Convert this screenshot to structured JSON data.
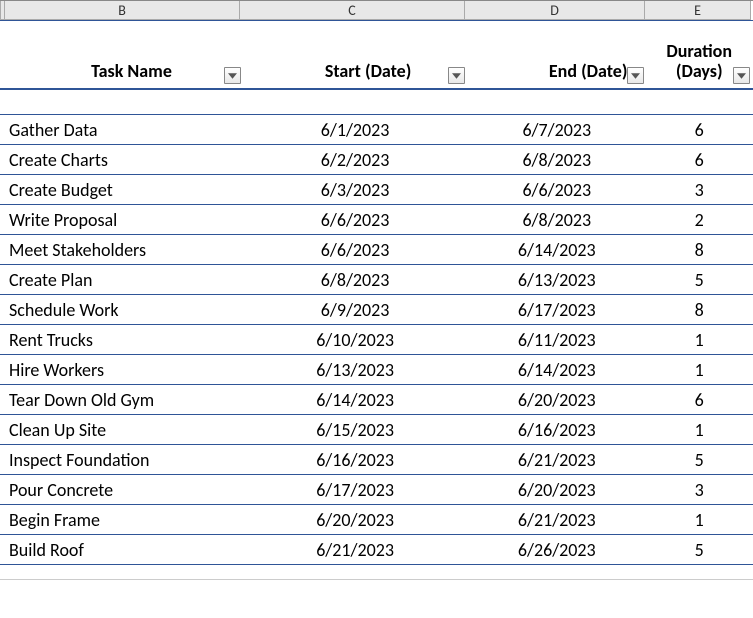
{
  "columns": {
    "B": "B",
    "C": "C",
    "D": "D",
    "E": "E"
  },
  "headers": {
    "task": "Task Name",
    "start": "Start  (Date)",
    "end": "End  (Date)",
    "duration_line1": "Duration",
    "duration_line2": "(Days)"
  },
  "rows": [
    {
      "task": "Gather Data",
      "start": "6/1/2023",
      "end": "6/7/2023",
      "duration": "6"
    },
    {
      "task": "Create Charts",
      "start": "6/2/2023",
      "end": "6/8/2023",
      "duration": "6"
    },
    {
      "task": "Create Budget",
      "start": "6/3/2023",
      "end": "6/6/2023",
      "duration": "3"
    },
    {
      "task": "Write Proposal",
      "start": "6/6/2023",
      "end": "6/8/2023",
      "duration": "2"
    },
    {
      "task": "Meet Stakeholders",
      "start": "6/6/2023",
      "end": "6/14/2023",
      "duration": "8"
    },
    {
      "task": "Create Plan",
      "start": "6/8/2023",
      "end": "6/13/2023",
      "duration": "5"
    },
    {
      "task": "Schedule Work",
      "start": "6/9/2023",
      "end": "6/17/2023",
      "duration": "8"
    },
    {
      "task": "Rent Trucks",
      "start": "6/10/2023",
      "end": "6/11/2023",
      "duration": "1"
    },
    {
      "task": "Hire Workers",
      "start": "6/13/2023",
      "end": "6/14/2023",
      "duration": "1"
    },
    {
      "task": "Tear Down Old Gym",
      "start": "6/14/2023",
      "end": "6/20/2023",
      "duration": "6"
    },
    {
      "task": "Clean Up Site",
      "start": "6/15/2023",
      "end": "6/16/2023",
      "duration": "1"
    },
    {
      "task": "Inspect Foundation",
      "start": "6/16/2023",
      "end": "6/21/2023",
      "duration": "5"
    },
    {
      "task": "Pour Concrete",
      "start": "6/17/2023",
      "end": "6/20/2023",
      "duration": "3"
    },
    {
      "task": "Begin Frame",
      "start": "6/20/2023",
      "end": "6/21/2023",
      "duration": "1"
    },
    {
      "task": "Build Roof",
      "start": "6/21/2023",
      "end": "6/26/2023",
      "duration": "5"
    }
  ]
}
